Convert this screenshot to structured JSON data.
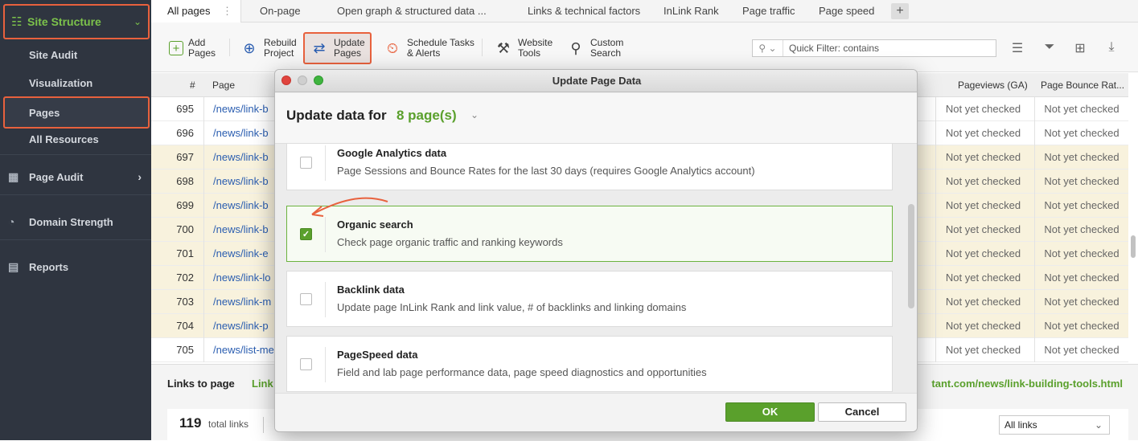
{
  "sidebar": {
    "header": "Site Structure",
    "sub_items": [
      "Site Audit",
      "Visualization",
      "Pages",
      "All Resources"
    ],
    "active_sub": "Pages",
    "main_items": [
      "Page Audit",
      "Domain Strength",
      "Reports"
    ]
  },
  "tabs": [
    "All pages",
    "On-page",
    "Open graph & structured data ...",
    "Links & technical factors",
    "InLink Rank",
    "Page traffic",
    "Page speed"
  ],
  "tab_add": "+",
  "toolbar": {
    "add": "Add\nPages",
    "rebuild": "Rebuild\nProject",
    "update": "Update\nPages",
    "schedule": "Schedule Tasks\n& Alerts",
    "website_tools": "Website\nTools",
    "custom_search": "Custom\nSearch",
    "filter_placeholder": "Quick Filter: contains"
  },
  "table": {
    "headers": {
      "num": "#",
      "page": "Page",
      "pageviews": "Pageviews (GA)",
      "bounce": "Page Bounce Rat..."
    },
    "rows": [
      {
        "num": "695",
        "page": "/news/link-b",
        "ga": "Not yet checked",
        "br": "Not yet checked",
        "hl": false
      },
      {
        "num": "696",
        "page": "/news/link-b",
        "ga": "Not yet checked",
        "br": "Not yet checked",
        "hl": false
      },
      {
        "num": "697",
        "page": "/news/link-b",
        "ga": "Not yet checked",
        "br": "Not yet checked",
        "hl": true
      },
      {
        "num": "698",
        "page": "/news/link-b",
        "ga": "Not yet checked",
        "br": "Not yet checked",
        "hl": true
      },
      {
        "num": "699",
        "page": "/news/link-b",
        "ga": "Not yet checked",
        "br": "Not yet checked",
        "hl": true
      },
      {
        "num": "700",
        "page": "/news/link-b",
        "ga": "Not yet checked",
        "br": "Not yet checked",
        "hl": true
      },
      {
        "num": "701",
        "page": "/news/link-e",
        "ga": "Not yet checked",
        "br": "Not yet checked",
        "hl": true
      },
      {
        "num": "702",
        "page": "/news/link-lo",
        "ga": "Not yet checked",
        "br": "Not yet checked",
        "hl": true
      },
      {
        "num": "703",
        "page": "/news/link-m",
        "ga": "Not yet checked",
        "br": "Not yet checked",
        "hl": true
      },
      {
        "num": "704",
        "page": "/news/link-p",
        "ga": "Not yet checked",
        "br": "Not yet checked",
        "hl": true
      },
      {
        "num": "705",
        "page": "/news/list-me",
        "ga": "Not yet checked",
        "br": "Not yet checked",
        "hl": false
      }
    ]
  },
  "bottom": {
    "title": "Links to page",
    "tab": "Link",
    "url": "tant.com/news/link-building-tools.html",
    "count": "119",
    "count_label": "total links",
    "select": "All links"
  },
  "modal": {
    "window_title": "Update Page Data",
    "header_text": "Update data for",
    "header_count": "8 page(s)",
    "options": [
      {
        "title": "Google Analytics data",
        "desc": "Page Sessions and Bounce Rates for the last 30 days (requires Google Analytics account)",
        "checked": false
      },
      {
        "title": "Organic search",
        "desc": "Check page organic traffic and ranking keywords",
        "checked": true
      },
      {
        "title": "Backlink data",
        "desc": "Update page InLink Rank and link value, # of backlinks and linking domains",
        "checked": false
      },
      {
        "title": "PageSpeed data",
        "desc": "Field and lab page performance data, page speed diagnostics and opportunities",
        "checked": false
      }
    ],
    "ok": "OK",
    "cancel": "Cancel"
  },
  "colors": {
    "accent_green": "#5aa02c",
    "highlight_orange": "#e8613d",
    "sidebar_bg": "#2f3540"
  }
}
